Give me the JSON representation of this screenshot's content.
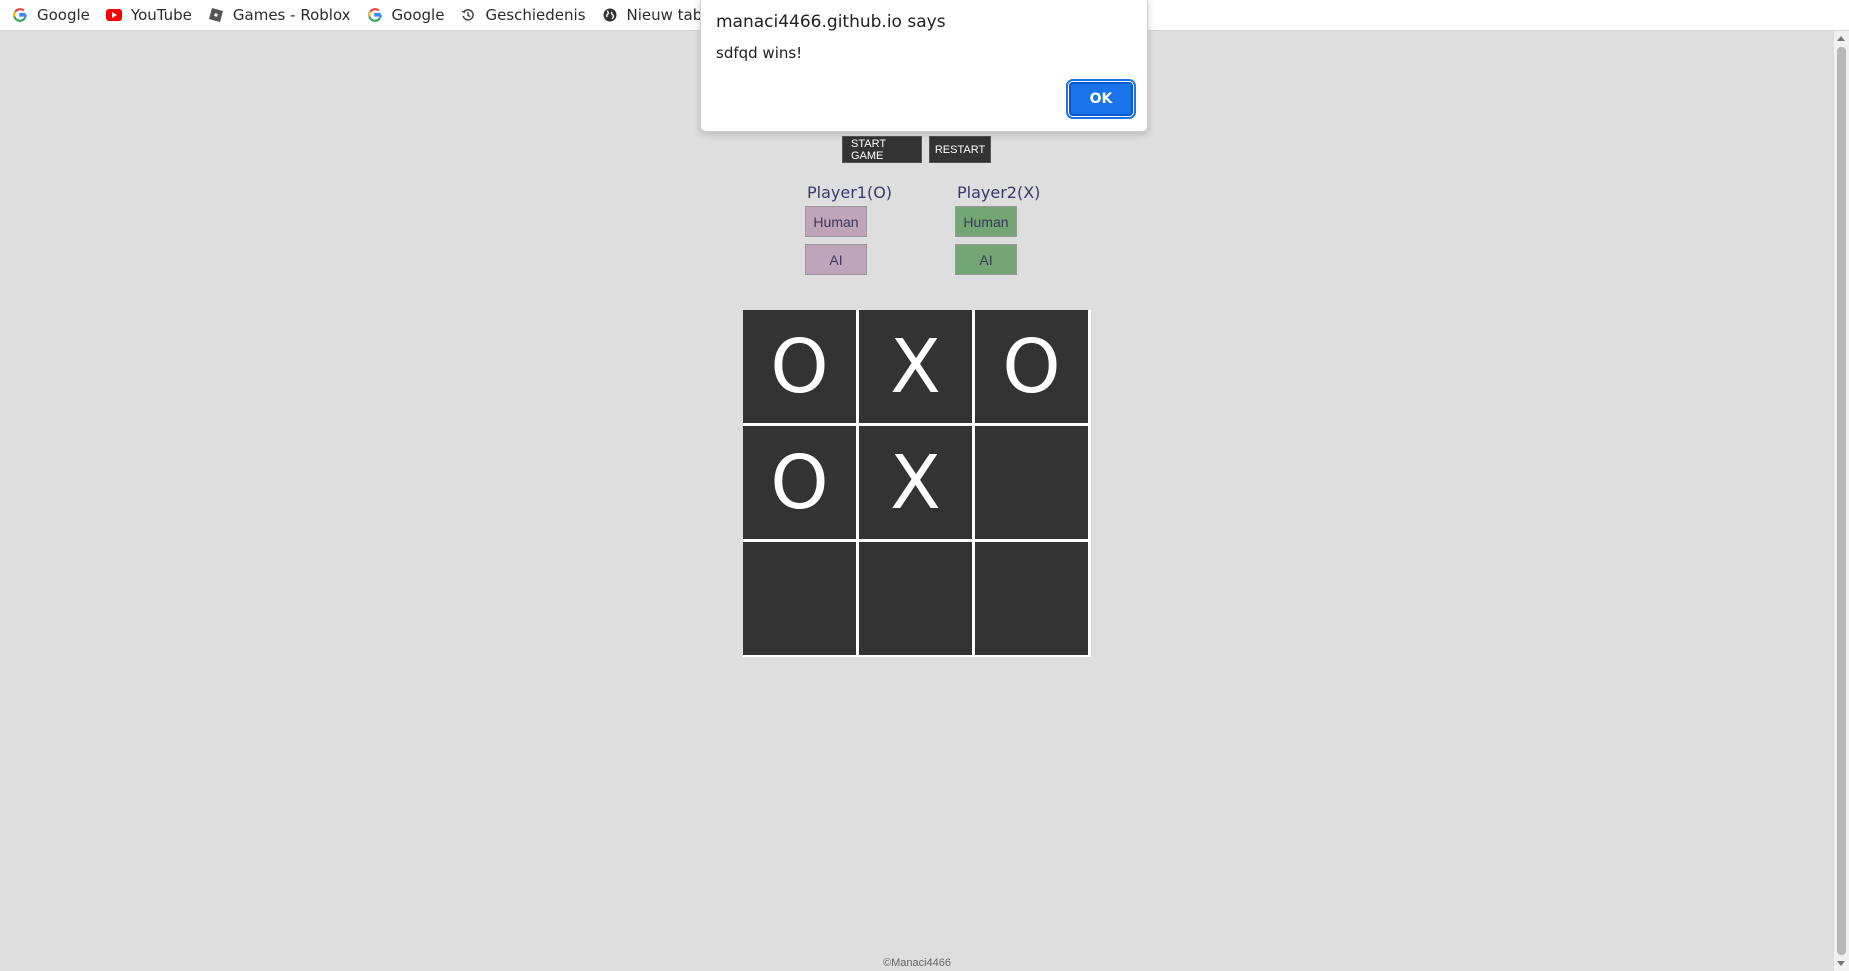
{
  "bookmarks": [
    {
      "label": "Google",
      "icon": "google-icon"
    },
    {
      "label": "YouTube",
      "icon": "youtube-icon"
    },
    {
      "label": "Games - Roblox",
      "icon": "roblox-icon"
    },
    {
      "label": "Google",
      "icon": "google-icon"
    },
    {
      "label": "Geschiedenis",
      "icon": "history-icon"
    },
    {
      "label": "Nieuw tabblad",
      "icon": "globe-icon"
    }
  ],
  "controls": {
    "start_label": "START GAME",
    "restart_label": "RESTART"
  },
  "players": [
    {
      "label": "Player1(O)",
      "options": [
        "Human",
        "AI"
      ],
      "color": "#c0a4ba"
    },
    {
      "label": "Player2(X)",
      "options": [
        "Human",
        "AI"
      ],
      "color": "#74a574"
    }
  ],
  "board": {
    "cells": [
      "O",
      "X",
      "O",
      "O",
      "X",
      "",
      "",
      "",
      ""
    ]
  },
  "footer": {
    "text": "©Manaci4466"
  },
  "alert": {
    "title": "manaci4466.github.io says",
    "message": "sdfqd wins!",
    "ok_label": "OK"
  },
  "colors": {
    "page_bg": "#dedede",
    "cell_bg": "#333333",
    "ok_button": "#1a73e8"
  }
}
